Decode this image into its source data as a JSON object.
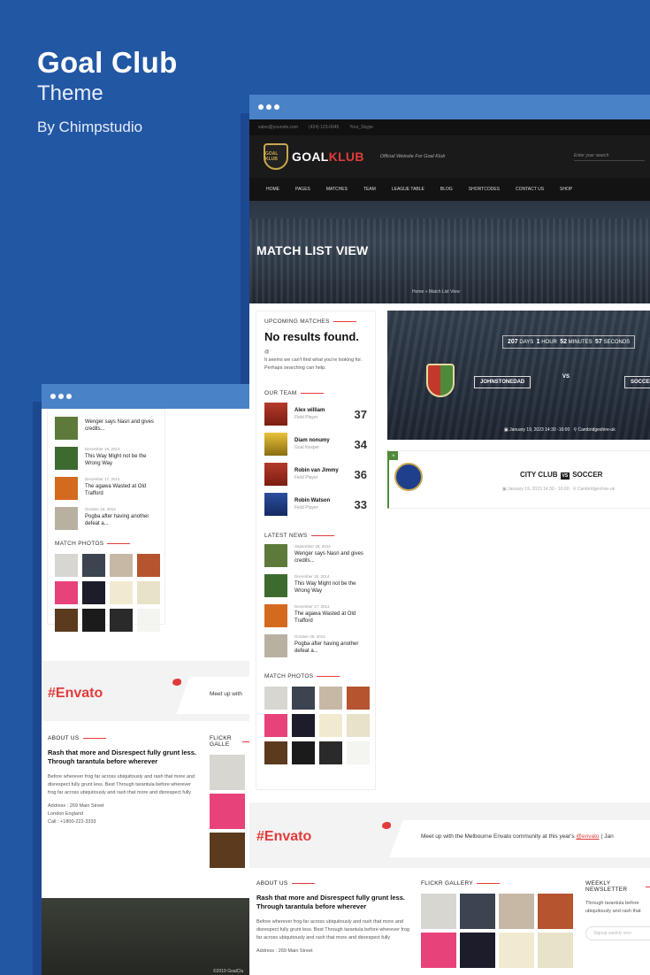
{
  "heading": {
    "title": "Goal Club",
    "subtitle": "Theme",
    "author": "By Chimpstudio"
  },
  "topbar": {
    "email": "sales@yoursite.com",
    "phone": "(424) 123-0045",
    "skype": "Your_Skype"
  },
  "logo": {
    "part1": "GOAL",
    "part2": "KLUB",
    "shield": "GOAL KLUB"
  },
  "tagline": "Official Website For Goal Klub",
  "search": {
    "placeholder": "Enter your search"
  },
  "nav": [
    "HOME",
    "PAGES",
    "MATCHES",
    "TEAM",
    "LEAGUE TABLE",
    "BLOG",
    "SHORTCODES",
    "CONTACT US",
    "SHOP"
  ],
  "hero": {
    "title": "MATCH LIST VIEW",
    "breadcrumb": "Home  »  Match List View"
  },
  "sidebar": {
    "upcoming_title": "UPCOMING MATCHES",
    "no_results": "No results found.",
    "no_results_icon": "@",
    "no_results_text": "It seems we can't find what you're looking for. Perhaps searching can help.",
    "team_title": "OUR TEAM",
    "players": [
      {
        "name": "Alex william",
        "role": "Field Player",
        "number": "37",
        "kit": "r"
      },
      {
        "name": "Diam nonumy",
        "role": "Goal Keeper",
        "number": "34",
        "kit": "y"
      },
      {
        "name": "Robin van Jimmy",
        "role": "Field Player",
        "number": "36",
        "kit": "r"
      },
      {
        "name": "Robin Watson",
        "role": "Field Player",
        "number": "33",
        "kit": "b"
      }
    ],
    "news_title": "LATEST NEWS",
    "news": [
      {
        "date": "September 28, 2014",
        "title": "Wenger says Nasri and gives credits...",
        "color": "#5d7a3a"
      },
      {
        "date": "December 18, 2014",
        "title": "This Way Might not be the Wrong Way",
        "color": "#3d6b2f"
      },
      {
        "date": "December 17, 2014",
        "title": "The agawa Wasted at Old Trafford",
        "color": "#d46a1e"
      },
      {
        "date": "October 26, 2014",
        "title": "Pogba after having another defeat a...",
        "color": "#b8b1a2"
      }
    ],
    "photos_title": "MATCH PHOTOS"
  },
  "back_sidebar": {
    "news": [
      {
        "date": "",
        "title": "Wenger says Nasri and gives credits...",
        "color": "#5d7a3a"
      },
      {
        "date": "December 18, 2014",
        "title": "This Way Might not be the Wrong Way",
        "color": "#3d6b2f"
      },
      {
        "date": "December 17, 2014",
        "title": "The agawa Wasted at Old Trafford",
        "color": "#d46a1e"
      },
      {
        "date": "October 26, 2014",
        "title": "Pogba after having another defeat a...",
        "color": "#b8b1a2"
      }
    ],
    "photos_title": "MATCH PHOTOS"
  },
  "photo_colors": [
    "#d8d6d0",
    "#3b4450",
    "#c7b8a6",
    "#b5542f",
    "#e8427a",
    "#1c1c2a",
    "#f2ead0",
    "#e7e2c8",
    "#5b3a1e",
    "#1b1b1b",
    "#2a2a2a",
    "#f4f4f0"
  ],
  "match1": {
    "days": "207",
    "days_label": "DAYS",
    "hours": "1",
    "hours_label": "HOUR",
    "minutes": "52",
    "minutes_label": "MINUTES",
    "seconds": "57",
    "seconds_label": "SECONDS",
    "team1": "JOHNSTONEDAD",
    "vs": "VS",
    "team2": "SOCCER",
    "date": "January 19, 2023  14:30 -16:00",
    "venue": "Cambridgeshire-uk"
  },
  "match2": {
    "team1": "CITY CLUB",
    "vs": "VS",
    "team2": "SOCCER",
    "date": "January 19, 2023  14:30 - 16:00",
    "venue": "Cambridgeshire-uk",
    "tag": "N"
  },
  "twitter": {
    "brand": "#Envato",
    "tweet": "Meet up with the Melbourne Envato community at this year's ",
    "handle": "@envato",
    "tweet_tail": " ( Jan",
    "back_tweet": "Meet up with"
  },
  "footer": {
    "about_title": "ABOUT US",
    "about_head": "Rash that more and Disrespect fully grunt less. Through tarantula before wherever",
    "about_text": "Before wherever frog far across ubiquitously and rash that more and disrespect fully grunt less. Best Through tarantula before wherever frog far across ubiquitously and rash that more and disrespect fully",
    "back_about_text": "Before wherever frog far across ubiquitously and rash that more and disrespect fully grunt less. Best Through tarantula before wherever frog far across ubiquitously and rash that more and disrespect fully",
    "address": "Address : 269 Main Street",
    "city": "London England",
    "call": "Call : +1800-222-3333",
    "flickr_title": "FLICKR GALLERY",
    "back_flickr_title": "FLICKR GALLE",
    "newsletter_title": "WEEKLY NEWSLETTER",
    "newsletter_text": "Through tarantula before ubiquitously and rash that",
    "newsletter_placeholder": "Signup weekly new",
    "copyright": "©2019 GoalClu"
  }
}
